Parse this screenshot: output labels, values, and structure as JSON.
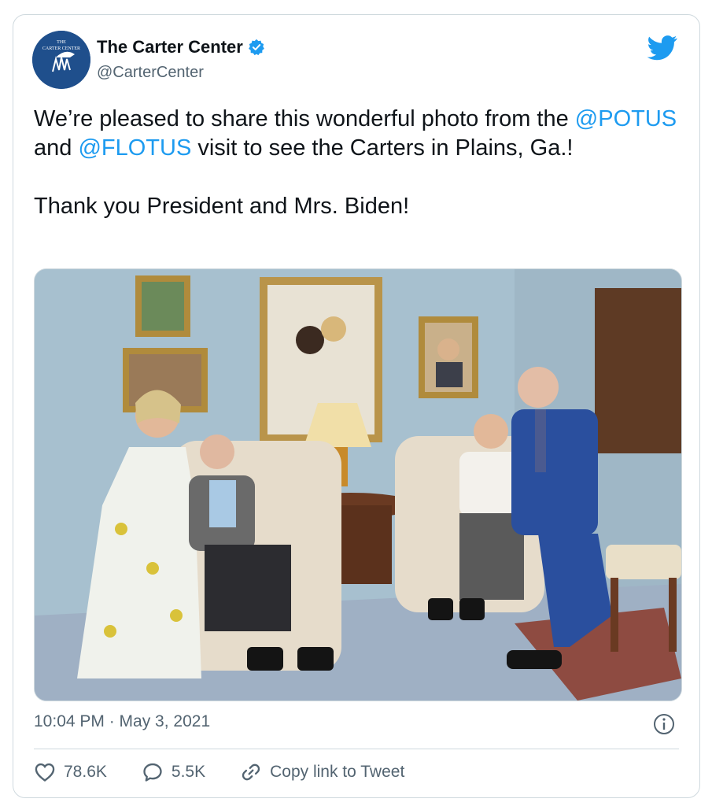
{
  "account": {
    "name": "The Carter Center",
    "handle": "@CarterCenter",
    "avatar_text_line1": "THE",
    "avatar_text_line2": "CARTER CENTER"
  },
  "tweet": {
    "text_part1": "We’re pleased to share this wonderful photo from the ",
    "mention1": "@POTUS",
    "text_part2": " and ",
    "mention2": "@FLOTUS",
    "text_part3": " visit to see the Carters in Plains, Ga.!",
    "paragraph2": "Thank you President and Mrs. Biden!"
  },
  "timestamp": "10:04 PM · May 3, 2021",
  "actions": {
    "likes": "78.6K",
    "replies": "5.5K",
    "copy_link": "Copy link to Tweet"
  },
  "colors": {
    "accent": "#1d9bf0",
    "secondary_text": "#536471",
    "border": "#cfd9de"
  },
  "icons": {
    "verified": "verified-badge-icon",
    "brand": "twitter-bird-icon",
    "info": "info-icon",
    "like": "heart-icon",
    "reply": "speech-bubble-icon",
    "link": "link-icon"
  }
}
